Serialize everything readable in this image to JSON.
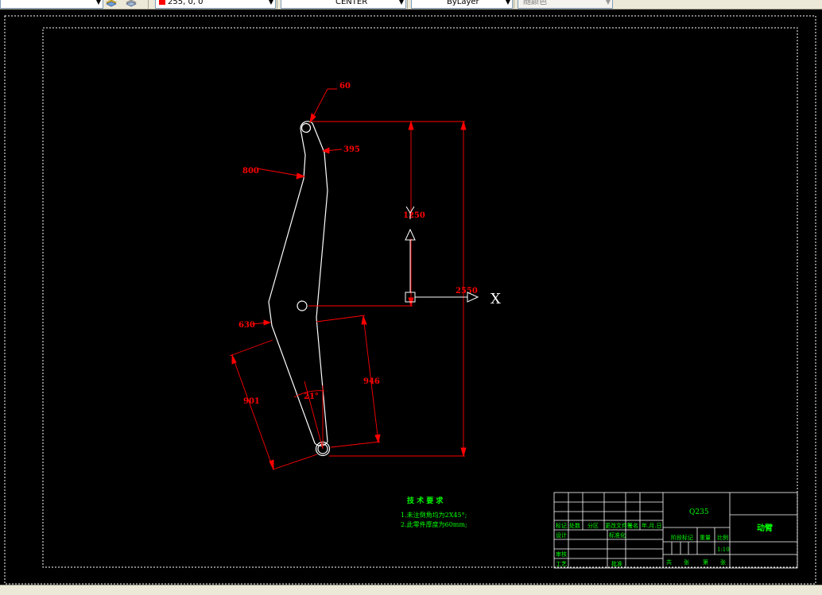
{
  "toolbar": {
    "color_value": "255, 0, 0",
    "linetype_value": "CENTER",
    "lineweight_value": "ByLayer",
    "plotstyle_value": "随颜色"
  },
  "drawing": {
    "dimensions": {
      "d60": "60",
      "d395": "395",
      "d800": "800",
      "d1250": "1250",
      "d2550": "2550",
      "d630": "630",
      "d901": "901",
      "d946": "946",
      "d21": "21°"
    },
    "ucs_x_label": "X",
    "tech_requirements": {
      "title": "技 术 要 求",
      "line1": "1.未注倒角均为2X45°;",
      "line2": "2.此零件厚度为60mm;"
    },
    "title_block": {
      "material": "Q235",
      "part_name": "动臂",
      "mark": "标记",
      "count": "处数",
      "zone": "分区",
      "doc_no": "更改文件号",
      "signature": "签名",
      "date": "年.月.日",
      "design": "设计",
      "standardize": "标准化",
      "stage_mark": "阶段标记",
      "weight": "重量",
      "scale": "比例",
      "scale_value": "1:10",
      "review": "审核",
      "process": "工艺",
      "approve": "批准",
      "total": "共",
      "sheet": "张",
      "page": "第",
      "sheet2": "张"
    }
  }
}
